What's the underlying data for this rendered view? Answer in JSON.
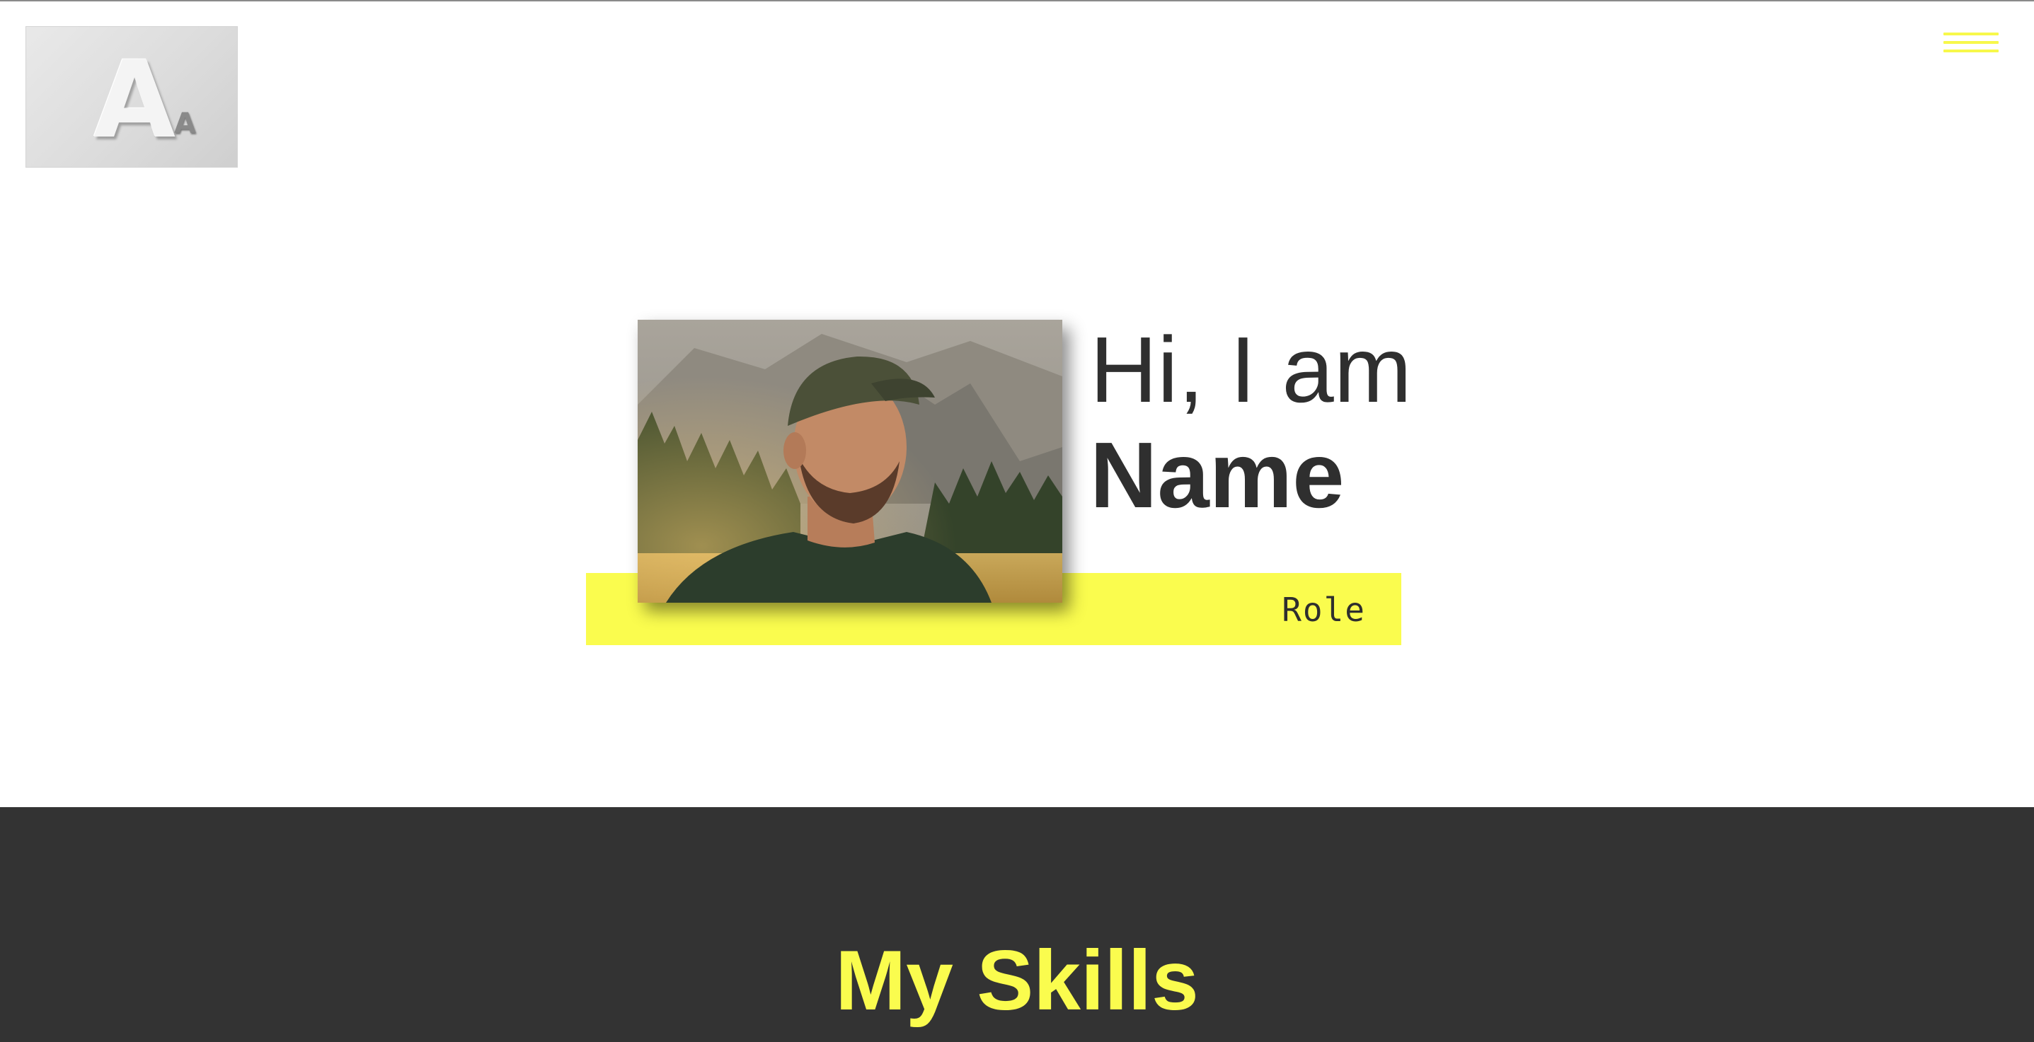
{
  "header": {
    "logo": {
      "big_letter": "A",
      "small_letter": "A",
      "icon": "logo-aa-icon"
    },
    "menu": {
      "icon": "hamburger-menu-icon"
    }
  },
  "hero": {
    "greeting": "Hi, I am",
    "name": "Name",
    "role": "Role",
    "portrait_icon": "portrait-photo"
  },
  "skills": {
    "title": "My Skills"
  },
  "colors": {
    "accent": "#fafc4e",
    "dark": "#333333",
    "text": "#2f2f2f",
    "background": "#ffffff"
  }
}
